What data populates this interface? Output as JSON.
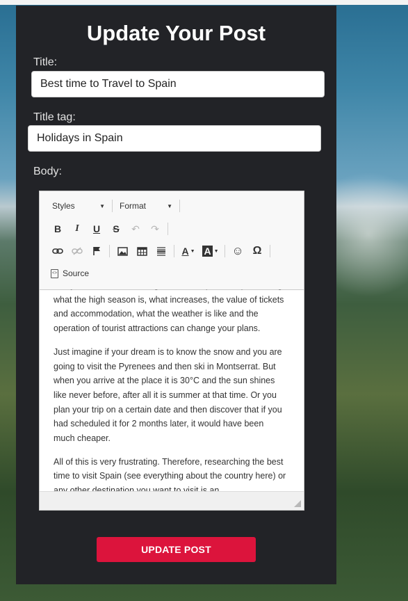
{
  "page": {
    "title": "Update Your Post"
  },
  "form": {
    "title_label": "Title:",
    "title_value": "Best time to Travel to Spain",
    "title_tag_label": "Title tag:",
    "title_tag_value": "Holidays in Spain",
    "body_label": "Body:"
  },
  "editor": {
    "toolbar": {
      "styles_label": "Styles",
      "format_label": "Format",
      "bold": "B",
      "italic": "I",
      "underline": "U",
      "strike": "S",
      "undo": "↶",
      "redo": "↷",
      "link": "🔗",
      "unlink": "⛓",
      "anchor": "⚑",
      "image": "▣",
      "table": "▦",
      "hr": "≣",
      "text_color": "A",
      "bg_color": "A",
      "smiley": "☺",
      "special_char": "Ω",
      "source_label": "Source"
    },
    "paragraphs": [
      "Many times we are thinking about the Spanish trip, knowing what the high season is, what increases, the value of tickets and accommodation, what the weather is like and the operation of tourist attractions can change your plans.",
      "Just imagine if your dream is to know the snow and you are going to visit the Pyrenees and then ski in Montserrat. But when you arrive at the place it is 30°C and the sun shines like never before, after all it is summer at that time. Or you plan your trip on a certain date and then discover that if you had scheduled it for 2 months later, it would have been much cheaper.",
      "All of this is very frustrating. Therefore, researching the best time to visit Spain (see everything about the country here) or any other destination you want to visit is an"
    ]
  },
  "actions": {
    "update_label": "UPDATE POST"
  },
  "colors": {
    "panel": "#222327",
    "accent": "#dc143c"
  }
}
